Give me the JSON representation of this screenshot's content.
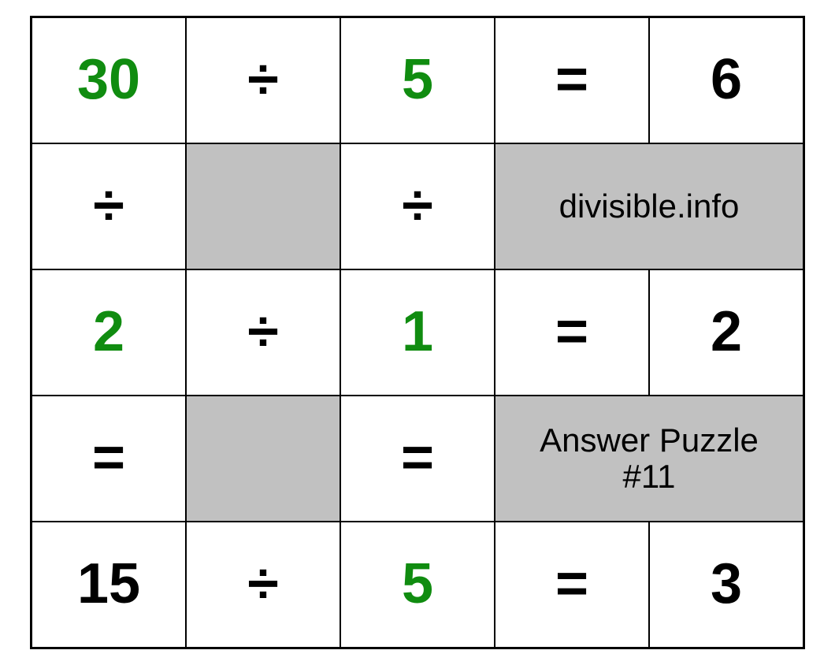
{
  "puzzle": {
    "site_label": "divisible.info",
    "answer_label": "Answer Puzzle\n#11",
    "rows": {
      "r1": {
        "a": "30",
        "op": "÷",
        "b": "5",
        "eq": "=",
        "res": "6"
      },
      "r2": {
        "col1": "÷",
        "col3": "÷"
      },
      "r3": {
        "a": "2",
        "op": "÷",
        "b": "1",
        "eq": "=",
        "res": "2"
      },
      "r4": {
        "col1": "=",
        "col3": "="
      },
      "r5": {
        "a": "15",
        "op": "÷",
        "b": "5",
        "eq": "=",
        "res": "3"
      }
    }
  }
}
